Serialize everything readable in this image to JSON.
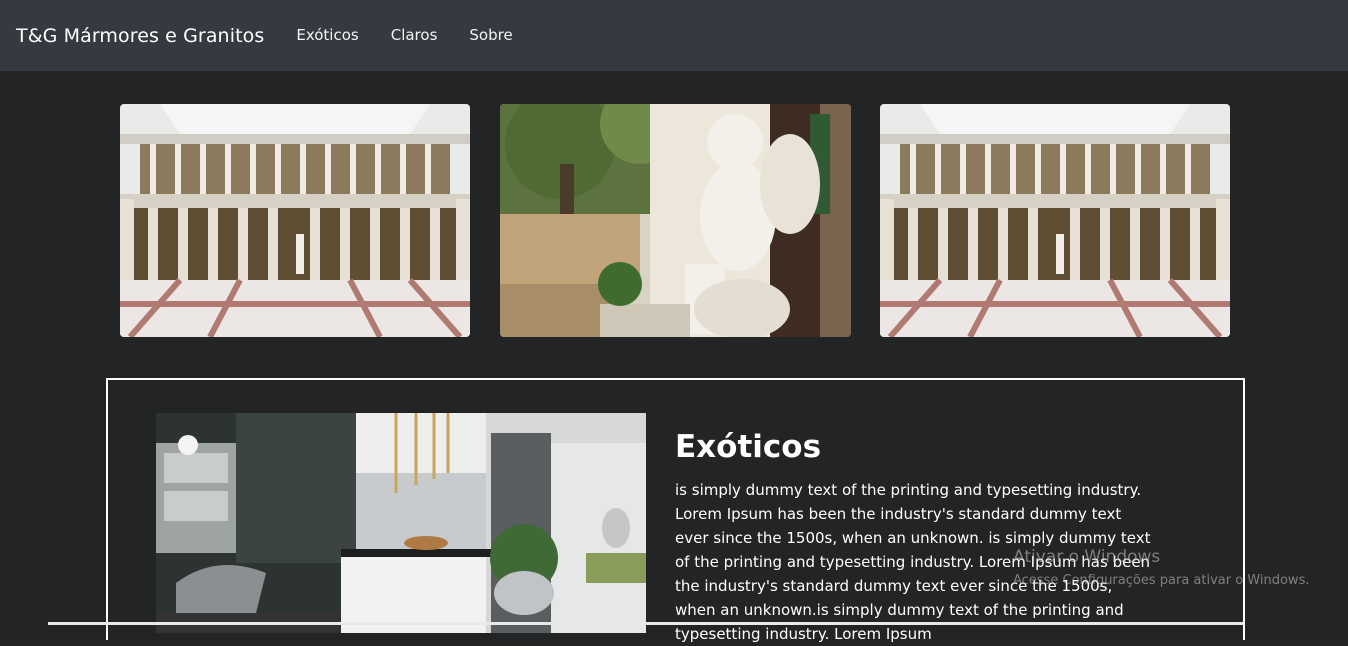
{
  "navbar": {
    "brand": "T&G Mármores e Granitos",
    "links": [
      "Exóticos",
      "Claros",
      "Sobre"
    ]
  },
  "gallery": {
    "images": [
      "marble-hall-photo",
      "angel-statue-photo",
      "marble-hall-photo"
    ]
  },
  "feature": {
    "title": "Exóticos",
    "text": "is simply dummy text of the printing and typesetting industry. Lorem Ipsum has been the industry's standard dummy text ever since the 1500s, when an unknown. is simply dummy text of the printing and typesetting industry. Lorem Ipsum has been the industry's standard dummy text ever since the 1500s, when an unknown.is simply dummy text of the printing and typesetting industry. Lorem Ipsum",
    "image": "kitchen-interior-photo"
  },
  "watermark": {
    "title": "Ativar o Windows",
    "subtitle": "Acesse Configurações para ativar o Windows."
  },
  "colors": {
    "navbar": "#343a40",
    "background": "#232425",
    "card_border": "#ffffff"
  }
}
